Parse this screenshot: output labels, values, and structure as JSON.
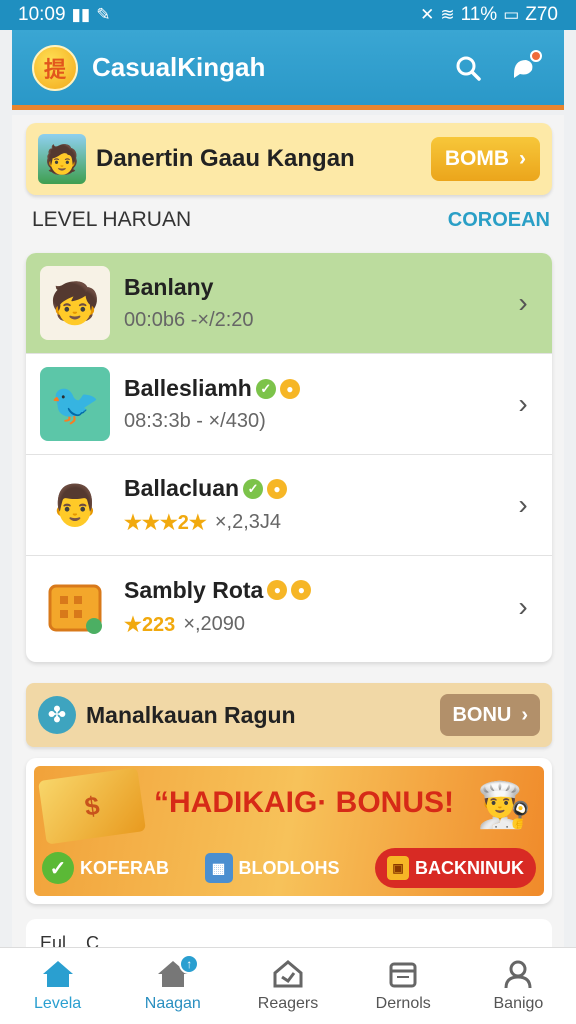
{
  "status_bar": {
    "time": "10:09",
    "battery_text": "11%",
    "extra": "Z70"
  },
  "header": {
    "title": "CasualKingah",
    "logo_glyph": "提"
  },
  "promo": {
    "text": "Danertin Gaau Kangan",
    "button_label": "BOMB"
  },
  "section": {
    "title": "LEVEL HARUAN",
    "link": "COROEAN"
  },
  "levels": [
    {
      "name": "Banlany",
      "sub": "00:0b6 -×/2:20",
      "stars": "",
      "active": true,
      "icon": "boy-hat-icon"
    },
    {
      "name": "Ballesliamh",
      "sub": "08:3:3b - ×/430)",
      "stars": "",
      "badges": true,
      "icon": "bird-icon"
    },
    {
      "name": "Ballacluan",
      "sub": "×,2,3J4",
      "stars": "★★★",
      "star_text": "2★",
      "badges": true,
      "icon": "man-icon"
    },
    {
      "name": "Sambly Rota",
      "sub": "×,2090",
      "stars": "★",
      "star_text": "223",
      "badges": true,
      "icon": "crate-icon"
    }
  ],
  "bonus": {
    "text": "Manalkauan Ragun",
    "button_label": "BONU"
  },
  "banner": {
    "title": "“HADIKAIG· BONUS!",
    "money_label": "$",
    "actions": [
      "KOFERAB",
      "BLODLOHS",
      "BACKNINUK"
    ]
  },
  "peek_text": "Eul... C...",
  "tabs": [
    {
      "label": "Levela",
      "icon": "home-icon"
    },
    {
      "label": "Naagan",
      "icon": "house-icon",
      "badge": "↑"
    },
    {
      "label": "Reagers",
      "icon": "tag-icon"
    },
    {
      "label": "Dernols",
      "icon": "calendar-icon"
    },
    {
      "label": "Banigo",
      "icon": "person-icon"
    }
  ],
  "colors": {
    "accent": "#2a9fd0",
    "header": "#2a98c8",
    "promo_bg": "#fde9a7",
    "active_row": "#bcdc9e",
    "bonus_bg": "#f1d8a6"
  }
}
